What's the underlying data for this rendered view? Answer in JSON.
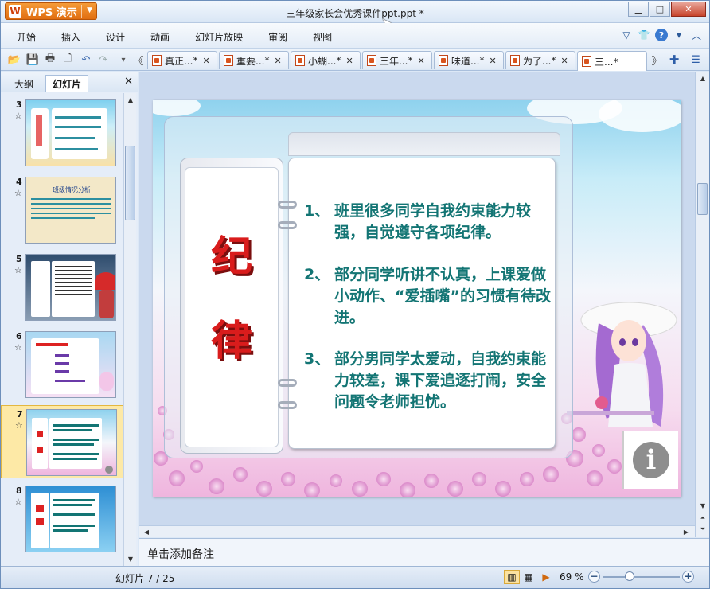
{
  "app": {
    "name": "WPS 演示",
    "window_title": "三年级家长会优秀课件ppt.ppt *"
  },
  "menu": {
    "items": [
      "开始",
      "插入",
      "设计",
      "动画",
      "幻灯片放映",
      "审阅",
      "视图"
    ]
  },
  "doc_tabs": [
    {
      "label": "真正...",
      "modified": "*"
    },
    {
      "label": "重要...",
      "modified": "*"
    },
    {
      "label": "小蝴...",
      "modified": "*"
    },
    {
      "label": "三年...",
      "modified": "*"
    },
    {
      "label": "味道...",
      "modified": "*"
    },
    {
      "label": "为了...",
      "modified": "*"
    },
    {
      "label": "三...*",
      "modified": ""
    }
  ],
  "left_panel": {
    "tabs": [
      "大纲",
      "幻灯片"
    ],
    "active_tab": "幻灯片",
    "thumbnails": [
      {
        "number": "3"
      },
      {
        "number": "4",
        "title": "班级情况分析"
      },
      {
        "number": "5"
      },
      {
        "number": "6"
      },
      {
        "number": "7",
        "selected": true
      },
      {
        "number": "8"
      }
    ]
  },
  "slide": {
    "title_chars": [
      "纪",
      "律"
    ],
    "points": [
      {
        "num": "1、",
        "text": "班里很多同学自我约束能力较强，自觉遵守各项纪律。"
      },
      {
        "num": "2、",
        "text": "部分同学听讲不认真，上课爱做小动作、“爱插嘴”的习惯有待改进。"
      },
      {
        "num": "3、",
        "text": "部分男同学太爱动，自我约束能力较差，课下爱追逐打闹，安全问题令老师担忧。"
      }
    ],
    "info_icon": "i"
  },
  "notes": {
    "placeholder": "单击添加备注"
  },
  "status": {
    "slide_count": "幻灯片 7 / 25",
    "zoom": "69 %"
  },
  "colors": {
    "accent": "#e8751a",
    "slide_text": "#137574",
    "title_red": "#d91c1c"
  }
}
